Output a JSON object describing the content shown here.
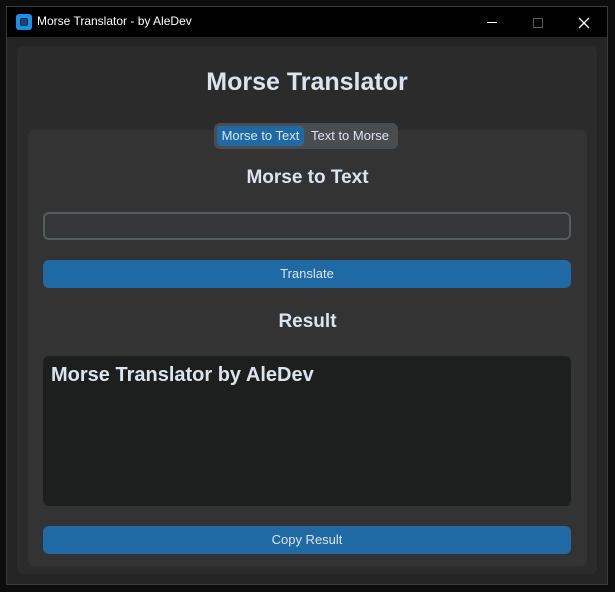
{
  "window": {
    "title": "Morse Translator - by AleDev"
  },
  "app": {
    "title": "Morse Translator"
  },
  "tabs": [
    {
      "label": "Morse to Text",
      "active": true
    },
    {
      "label": "Text to Morse",
      "active": false
    }
  ],
  "morse_to_text": {
    "heading": "Morse to Text",
    "input_value": "",
    "translate_label": "Translate",
    "result_heading": "Result",
    "result_text": "Morse Translator by AleDev",
    "copy_label": "Copy Result"
  },
  "colors": {
    "accent": "#1f6aa5",
    "window_bg": "#242424",
    "frame_bg": "#2b2b2b",
    "tab_bg": "#333333",
    "result_bg": "#1d1e1e",
    "text": "#dce4ee"
  },
  "icons": {
    "app": "app-icon",
    "minimize": "minimize-icon",
    "maximize": "maximize-icon",
    "close": "close-icon"
  }
}
